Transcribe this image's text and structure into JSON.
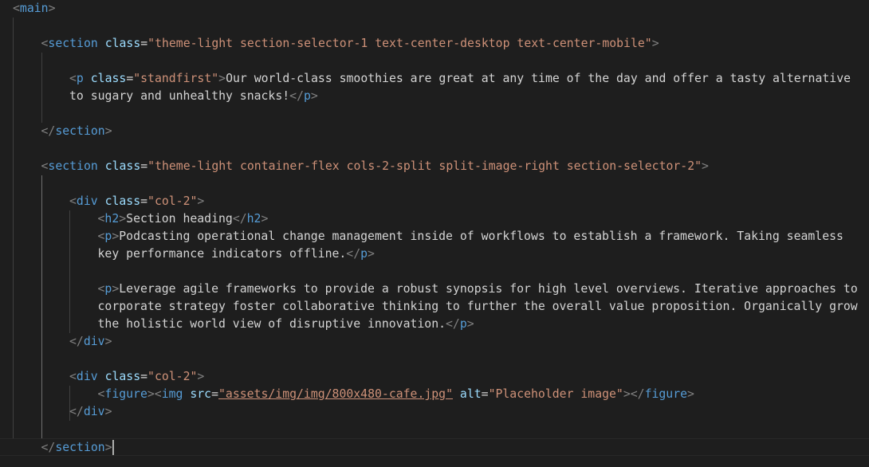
{
  "editor": {
    "language": "html",
    "colors": {
      "background": "#1e1e1e",
      "tag": "#569cd6",
      "attribute": "#9cdcfe",
      "string": "#ce9178",
      "text": "#d4d4d4",
      "punctuation": "#808080"
    },
    "lines": [
      {
        "indent": 0,
        "tokens": [
          {
            "c": "p",
            "v": "<"
          },
          {
            "c": "tag",
            "v": "main"
          },
          {
            "c": "p",
            "v": ">"
          }
        ]
      },
      {
        "indent": 0,
        "tokens": []
      },
      {
        "indent": 1,
        "tokens": [
          {
            "c": "p",
            "v": "<"
          },
          {
            "c": "tag",
            "v": "section"
          },
          {
            "c": "text",
            "v": " "
          },
          {
            "c": "attr",
            "v": "class"
          },
          {
            "c": "text",
            "v": "="
          },
          {
            "c": "str",
            "v": "\"theme-light section-selector-1 text-center-desktop text-center-mobile\""
          },
          {
            "c": "p",
            "v": ">"
          }
        ]
      },
      {
        "indent": 0,
        "tokens": []
      },
      {
        "indent": 2,
        "tokens": [
          {
            "c": "p",
            "v": "<"
          },
          {
            "c": "tag",
            "v": "p"
          },
          {
            "c": "text",
            "v": " "
          },
          {
            "c": "attr",
            "v": "class"
          },
          {
            "c": "text",
            "v": "="
          },
          {
            "c": "str",
            "v": "\"standfirst\""
          },
          {
            "c": "p",
            "v": ">"
          },
          {
            "c": "text",
            "v": "Our world-class smoothies are great at any time of the day and offer a tasty alternative"
          }
        ]
      },
      {
        "indent": 2,
        "tokens": [
          {
            "c": "text",
            "v": "to sugary and unhealthy snacks!"
          },
          {
            "c": "p",
            "v": "</"
          },
          {
            "c": "tag",
            "v": "p"
          },
          {
            "c": "p",
            "v": ">"
          }
        ]
      },
      {
        "indent": 0,
        "tokens": []
      },
      {
        "indent": 1,
        "tokens": [
          {
            "c": "p",
            "v": "</"
          },
          {
            "c": "tag",
            "v": "section"
          },
          {
            "c": "p",
            "v": ">"
          }
        ]
      },
      {
        "indent": 0,
        "tokens": []
      },
      {
        "indent": 1,
        "tokens": [
          {
            "c": "p",
            "v": "<"
          },
          {
            "c": "tag",
            "v": "section"
          },
          {
            "c": "text",
            "v": " "
          },
          {
            "c": "attr",
            "v": "class"
          },
          {
            "c": "text",
            "v": "="
          },
          {
            "c": "str",
            "v": "\"theme-light container-flex cols-2-split split-image-right section-selector-2\""
          },
          {
            "c": "p",
            "v": ">"
          }
        ]
      },
      {
        "indent": 0,
        "tokens": []
      },
      {
        "indent": 2,
        "tokens": [
          {
            "c": "p",
            "v": "<"
          },
          {
            "c": "tag",
            "v": "div"
          },
          {
            "c": "text",
            "v": " "
          },
          {
            "c": "attr",
            "v": "class"
          },
          {
            "c": "text",
            "v": "="
          },
          {
            "c": "str",
            "v": "\"col-2\""
          },
          {
            "c": "p",
            "v": ">"
          }
        ]
      },
      {
        "indent": 3,
        "tokens": [
          {
            "c": "p",
            "v": "<"
          },
          {
            "c": "tag",
            "v": "h2"
          },
          {
            "c": "p",
            "v": ">"
          },
          {
            "c": "text",
            "v": "Section heading"
          },
          {
            "c": "p",
            "v": "</"
          },
          {
            "c": "tag",
            "v": "h2"
          },
          {
            "c": "p",
            "v": ">"
          }
        ]
      },
      {
        "indent": 3,
        "tokens": [
          {
            "c": "p",
            "v": "<"
          },
          {
            "c": "tag",
            "v": "p"
          },
          {
            "c": "p",
            "v": ">"
          },
          {
            "c": "text",
            "v": "Podcasting operational change management inside of workflows to establish a framework. Taking seamless"
          }
        ]
      },
      {
        "indent": 3,
        "tokens": [
          {
            "c": "text",
            "v": "key performance indicators offline."
          },
          {
            "c": "p",
            "v": "</"
          },
          {
            "c": "tag",
            "v": "p"
          },
          {
            "c": "p",
            "v": ">"
          }
        ]
      },
      {
        "indent": 0,
        "tokens": []
      },
      {
        "indent": 3,
        "tokens": [
          {
            "c": "p",
            "v": "<"
          },
          {
            "c": "tag",
            "v": "p"
          },
          {
            "c": "p",
            "v": ">"
          },
          {
            "c": "text",
            "v": "Leverage agile frameworks to provide a robust synopsis for high level overviews. Iterative approaches to"
          }
        ]
      },
      {
        "indent": 3,
        "tokens": [
          {
            "c": "text",
            "v": "corporate strategy foster collaborative thinking to further the overall value proposition. Organically grow"
          }
        ]
      },
      {
        "indent": 3,
        "tokens": [
          {
            "c": "text",
            "v": "the holistic world view of disruptive innovation."
          },
          {
            "c": "p",
            "v": "</"
          },
          {
            "c": "tag",
            "v": "p"
          },
          {
            "c": "p",
            "v": ">"
          }
        ]
      },
      {
        "indent": 2,
        "tokens": [
          {
            "c": "p",
            "v": "</"
          },
          {
            "c": "tag",
            "v": "div"
          },
          {
            "c": "p",
            "v": ">"
          }
        ]
      },
      {
        "indent": 0,
        "tokens": []
      },
      {
        "indent": 2,
        "tokens": [
          {
            "c": "p",
            "v": "<"
          },
          {
            "c": "tag",
            "v": "div"
          },
          {
            "c": "text",
            "v": " "
          },
          {
            "c": "attr",
            "v": "class"
          },
          {
            "c": "text",
            "v": "="
          },
          {
            "c": "str",
            "v": "\"col-2\""
          },
          {
            "c": "p",
            "v": ">"
          }
        ]
      },
      {
        "indent": 3,
        "tokens": [
          {
            "c": "p",
            "v": "<"
          },
          {
            "c": "tag",
            "v": "figure"
          },
          {
            "c": "p",
            "v": "><"
          },
          {
            "c": "tag",
            "v": "img"
          },
          {
            "c": "text",
            "v": " "
          },
          {
            "c": "attr",
            "v": "src"
          },
          {
            "c": "text",
            "v": "="
          },
          {
            "c": "link",
            "v": "\"assets/img/img/800x480-cafe.jpg\""
          },
          {
            "c": "text",
            "v": " "
          },
          {
            "c": "attr",
            "v": "alt"
          },
          {
            "c": "text",
            "v": "="
          },
          {
            "c": "str",
            "v": "\"Placeholder image\""
          },
          {
            "c": "p",
            "v": "></"
          },
          {
            "c": "tag",
            "v": "figure"
          },
          {
            "c": "p",
            "v": ">"
          }
        ]
      },
      {
        "indent": 2,
        "tokens": [
          {
            "c": "p",
            "v": "</"
          },
          {
            "c": "tag",
            "v": "div"
          },
          {
            "c": "p",
            "v": ">"
          }
        ]
      },
      {
        "indent": 0,
        "tokens": []
      },
      {
        "indent": 1,
        "tokens": [
          {
            "c": "p",
            "v": "</"
          },
          {
            "c": "tag",
            "v": "section"
          },
          {
            "c": "p",
            "v": ">"
          }
        ],
        "cursor": true
      }
    ]
  }
}
